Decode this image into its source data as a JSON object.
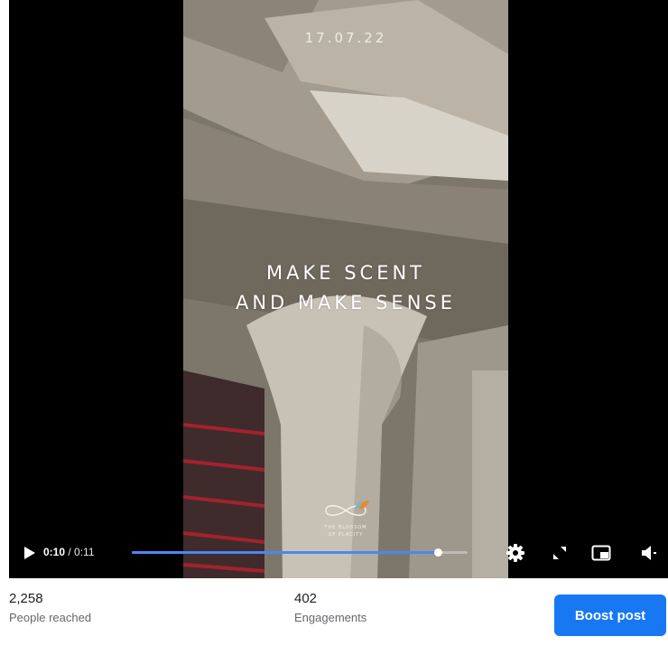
{
  "video": {
    "overlay_date": "17.07.22",
    "headline_line1": "MAKE SCENT",
    "headline_line2": "AND MAKE SENSE",
    "brand_line1": "THE BLOSSOM",
    "brand_line2": "OF PLACITY"
  },
  "controls": {
    "current_time": "0:10",
    "separator": " / ",
    "total_time": "0:11",
    "progress_fraction": 0.91,
    "icons": [
      "play-icon",
      "settings-icon",
      "fullscreen-icon",
      "picture-in-picture-icon",
      "volume-icon"
    ]
  },
  "stats": {
    "reach_value": "2,258",
    "reach_label": "People reached",
    "engagement_value": "402",
    "engagement_label": "Engagements"
  },
  "actions": {
    "boost_label": "Boost post"
  },
  "colors": {
    "accent": "#1877f2",
    "progress": "#4a86f7",
    "player_bg": "#000000"
  }
}
